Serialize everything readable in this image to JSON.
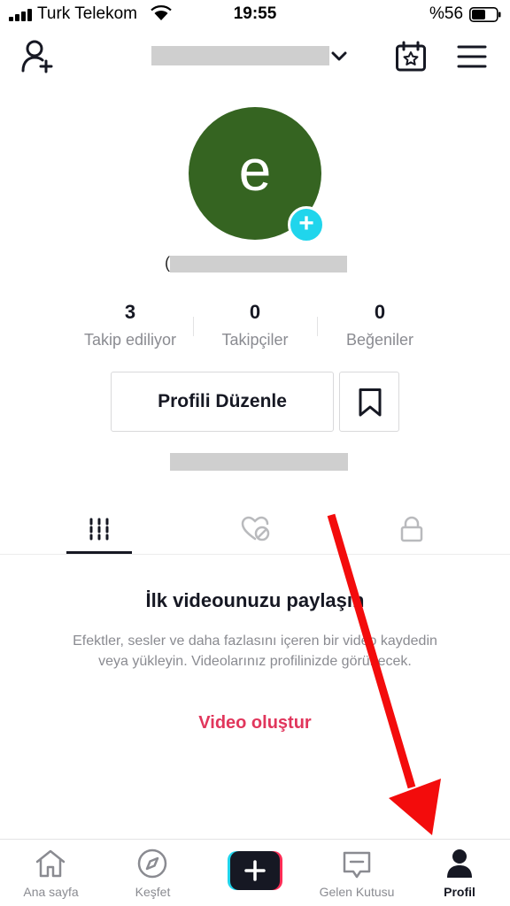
{
  "status_bar": {
    "carrier": "Turk Telekom",
    "time": "19:55",
    "battery": "%56"
  },
  "profile": {
    "avatar_letter": "e",
    "handle_prefix": "("
  },
  "stats": [
    {
      "value": "3",
      "label": "Takip ediliyor"
    },
    {
      "value": "0",
      "label": "Takipçiler"
    },
    {
      "value": "0",
      "label": "Beğeniler"
    }
  ],
  "actions": {
    "edit_label": "Profili Düzenle"
  },
  "empty_state": {
    "title": "İlk videounuzu paylaşın",
    "description": "Efektler, sesler ve daha fazlasını içeren bir video kaydedin veya yükleyin. Videolarınız profilinizde görünecek.",
    "cta": "Video oluştur"
  },
  "nav": [
    {
      "label": "Ana sayfa",
      "icon": "home-icon"
    },
    {
      "label": "Keşfet",
      "icon": "compass-icon"
    },
    {
      "label": "",
      "icon": "plus-icon"
    },
    {
      "label": "Gelen Kutusu",
      "icon": "inbox-icon"
    },
    {
      "label": "Profil",
      "icon": "person-icon"
    }
  ],
  "colors": {
    "avatar_bg": "#356421",
    "accent_cyan": "#20d5ec",
    "accent_pink": "#e1365c",
    "annotation_red": "#f30c0c"
  }
}
